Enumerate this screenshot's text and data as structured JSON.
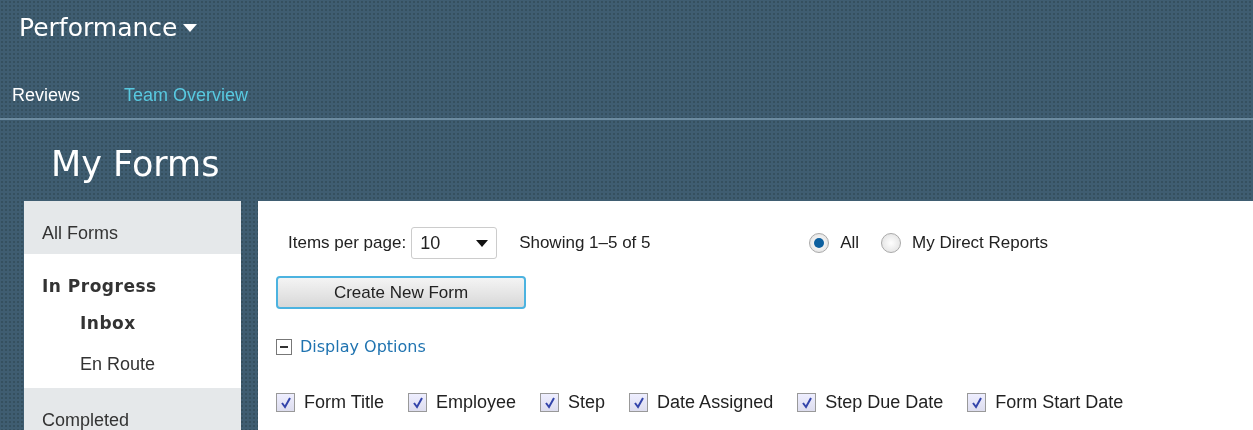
{
  "app_title": "Performance",
  "nav": [
    {
      "label": "Reviews",
      "selected": true
    },
    {
      "label": "Team Overview",
      "selected": false
    }
  ],
  "page_title": "My Forms",
  "sidebar": {
    "items": [
      {
        "label": "All Forms",
        "expanded": false,
        "selected": false
      },
      {
        "label": "In Progress",
        "expanded": true,
        "selected": false,
        "children": [
          {
            "label": "Inbox",
            "selected": true
          },
          {
            "label": "En Route",
            "selected": false
          }
        ]
      },
      {
        "label": "Completed",
        "expanded": false,
        "selected": false
      }
    ]
  },
  "toolbar": {
    "items_per_page_label": "Items per page:",
    "items_per_page": "10",
    "showing": "Showing 1–5 of 5",
    "filters": [
      {
        "label": "All",
        "selected": true
      },
      {
        "label": "My Direct Reports",
        "selected": false
      }
    ]
  },
  "create_button": "Create New Form",
  "display_options": {
    "label": "Display Options",
    "expanded": true,
    "columns": [
      {
        "label": "Form Title",
        "checked": true
      },
      {
        "label": "Employee",
        "checked": true
      },
      {
        "label": "Step",
        "checked": true
      },
      {
        "label": "Date Assigned",
        "checked": true
      },
      {
        "label": "Step Due Date",
        "checked": true
      },
      {
        "label": "Form Start Date",
        "checked": true
      }
    ]
  }
}
